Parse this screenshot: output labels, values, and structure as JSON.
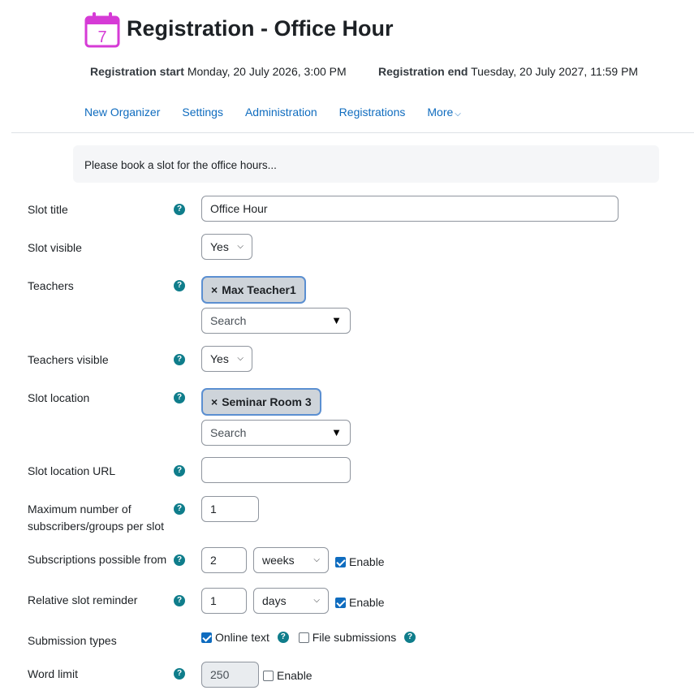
{
  "header": {
    "title": "Registration - Office Hour",
    "calendar_icon_number": "7",
    "start_label": "Registration start",
    "start_value": "Monday, 20 July 2026, 3:00 PM",
    "end_label": "Registration end",
    "end_value": "Tuesday, 20 July 2027, 11:59 PM"
  },
  "tabs": [
    {
      "label": "New Organizer"
    },
    {
      "label": "Settings"
    },
    {
      "label": "Administration"
    },
    {
      "label": "Registrations"
    },
    {
      "label": "More"
    }
  ],
  "intro": "Please book a slot for the office hours...",
  "form": {
    "slot_title": {
      "label": "Slot title",
      "value": "Office Hour"
    },
    "slot_visible": {
      "label": "Slot visible",
      "value": "Yes"
    },
    "teachers": {
      "label": "Teachers",
      "chip": "Max Teacher1",
      "search": "Search"
    },
    "teachers_visible": {
      "label": "Teachers visible",
      "value": "Yes"
    },
    "slot_location": {
      "label": "Slot location",
      "chip": "Seminar Room 3",
      "search": "Search"
    },
    "slot_location_url": {
      "label": "Slot location URL",
      "value": ""
    },
    "max_subscribers": {
      "label_line1": "Maximum number of",
      "label_line2": "subscribers/groups per slot",
      "value": "1"
    },
    "subscriptions_from": {
      "label": "Subscriptions possible from",
      "value": "2",
      "unit": "weeks",
      "enable": "Enable"
    },
    "relative_reminder": {
      "label": "Relative slot reminder",
      "value": "1",
      "unit": "days",
      "enable": "Enable"
    },
    "submission_types": {
      "label": "Submission types",
      "online_text": "Online text",
      "file_submissions": "File submissions"
    },
    "word_limit": {
      "label": "Word limit",
      "value": "250",
      "enable": "Enable"
    }
  },
  "colors": {
    "link": "#0f6cbf",
    "help": "#0f7d8b",
    "calendar": "#d63bd6",
    "chip_border": "#5b8fd1"
  }
}
